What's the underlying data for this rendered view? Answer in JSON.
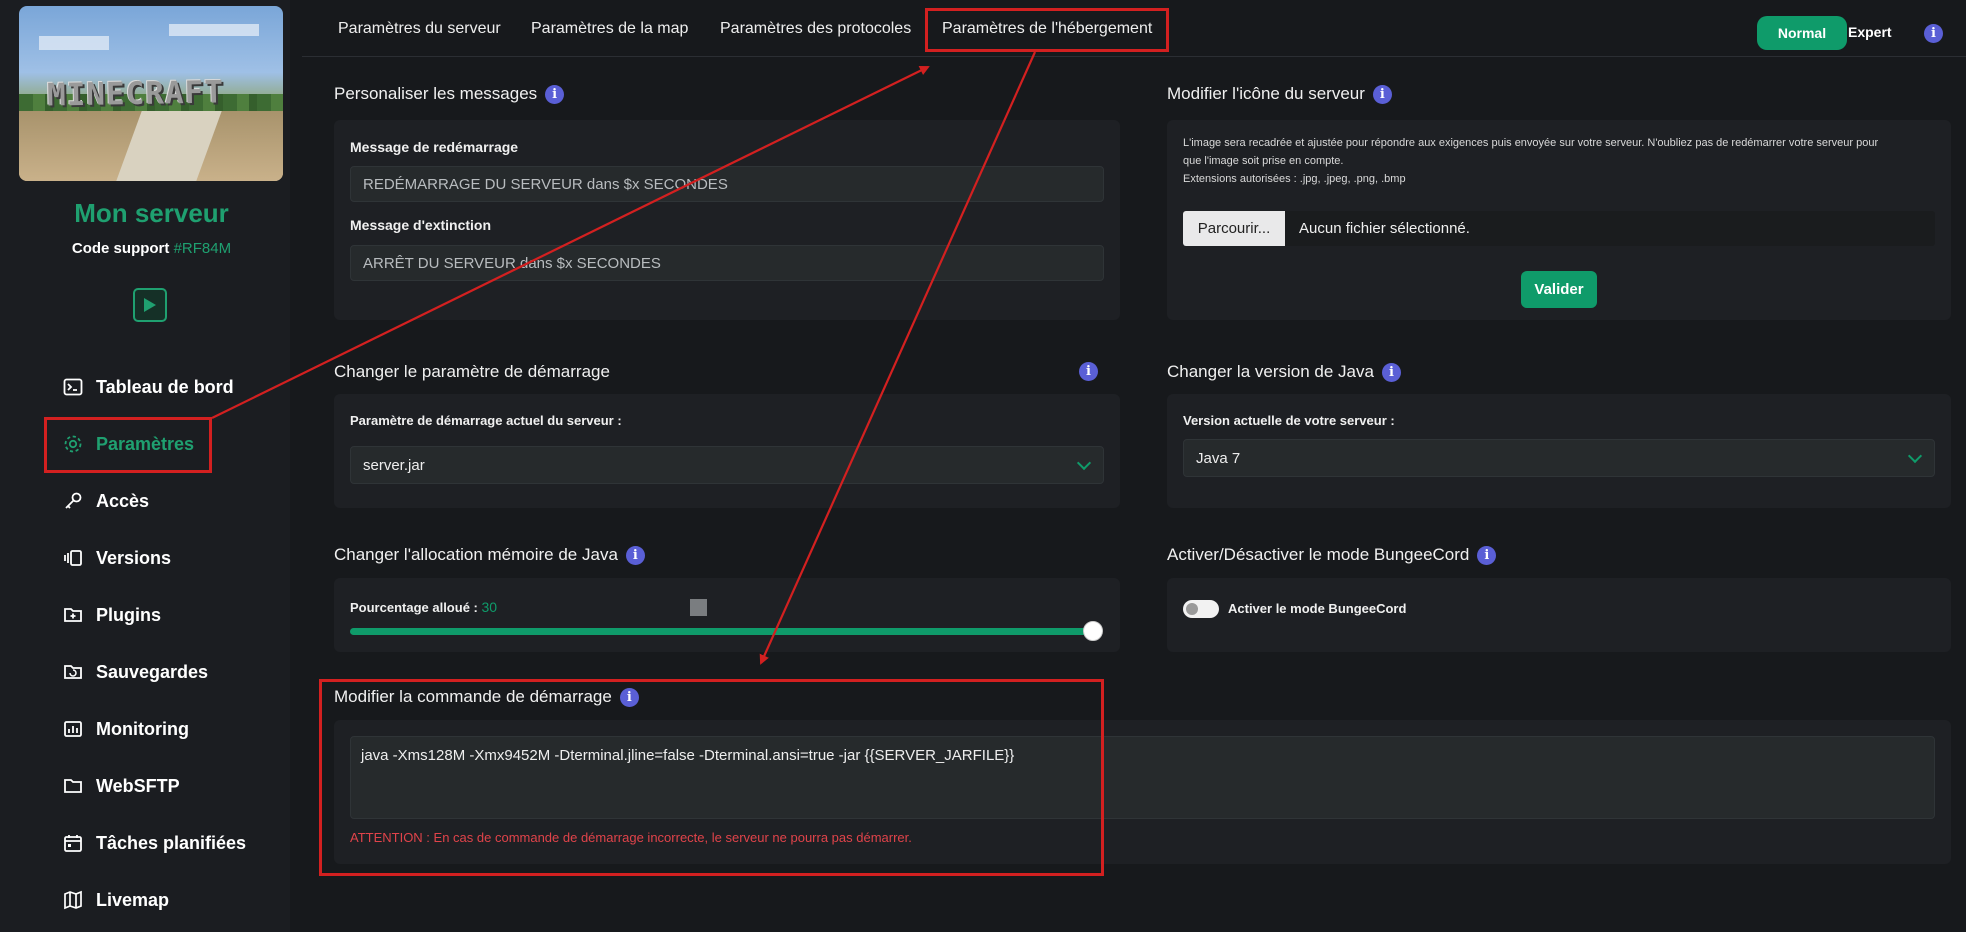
{
  "sidebar": {
    "banner_logo_text": "MINECRAFT",
    "server_name": "Mon serveur",
    "support_label": "Code support",
    "support_code": "#RF84M",
    "nav": [
      {
        "label": "Tableau de bord",
        "icon": "terminal-icon"
      },
      {
        "label": "Paramètres",
        "icon": "gear-icon",
        "active": true
      },
      {
        "label": "Accès",
        "icon": "key-icon"
      },
      {
        "label": "Versions",
        "icon": "versions-icon"
      },
      {
        "label": "Plugins",
        "icon": "plugin-folder-icon"
      },
      {
        "label": "Sauvegardes",
        "icon": "backup-folder-icon"
      },
      {
        "label": "Monitoring",
        "icon": "chart-icon"
      },
      {
        "label": "WebSFTP",
        "icon": "folder-icon"
      },
      {
        "label": "Tâches planifiées",
        "icon": "calendar-icon"
      },
      {
        "label": "Livemap",
        "icon": "map-icon"
      }
    ]
  },
  "tabs": [
    "Paramètres du serveur",
    "Paramètres de la map",
    "Paramètres des protocoles",
    "Paramètres de l'hébergement"
  ],
  "mode": {
    "normal": "Normal",
    "expert": "Expert"
  },
  "messages": {
    "title": "Personaliser les messages",
    "restart_label": "Message de redémarrage",
    "restart_value": "REDÉMARRAGE DU SERVEUR dans $x SECONDES",
    "shutdown_label": "Message d'extinction",
    "shutdown_value": "ARRÊT DU SERVEUR dans $x SECONDES"
  },
  "icon_section": {
    "title": "Modifier l'icône du serveur",
    "desc_line1": "L'image sera recadrée et ajustée pour répondre aux exigences puis envoyée sur votre serveur. N'oubliez pas de redémarrer votre serveur pour",
    "desc_line2": "que l'image soit prise en compte.",
    "desc_line3": "Extensions autorisées : .jpg, .jpeg, .png, .bmp",
    "browse_label": "Parcourir...",
    "file_status": "Aucun fichier sélectionné.",
    "validate_label": "Valider"
  },
  "startup_param": {
    "title": "Changer le paramètre de démarrage",
    "label": "Paramètre de démarrage actuel du serveur :",
    "value": "server.jar"
  },
  "java_version": {
    "title": "Changer la version de Java",
    "label": "Version actuelle de votre serveur :",
    "value": "Java 7"
  },
  "memory": {
    "title": "Changer l'allocation mémoire de Java",
    "label": "Pourcentage alloué :",
    "value": "30",
    "slider_fraction": 1.0
  },
  "bungee": {
    "title": "Activer/Désactiver le mode BungeeCord",
    "toggle_label": "Activer le mode BungeeCord",
    "enabled": false
  },
  "command": {
    "title": "Modifier la commande de démarrage",
    "value": "java -Xms128M -Xmx9452M -Dterminal.jline=false -Dterminal.ansi=true -jar {{SERVER_JARFILE}}",
    "warning": "ATTENTION : En cas de commande de démarrage incorrecte, le serveur ne pourra pas démarrer."
  },
  "info_icon_text": "i",
  "colors": {
    "accent": "#0f9b6a",
    "annotation_red": "#d32020",
    "info": "#5a5fd6",
    "warning": "#e0434a"
  }
}
